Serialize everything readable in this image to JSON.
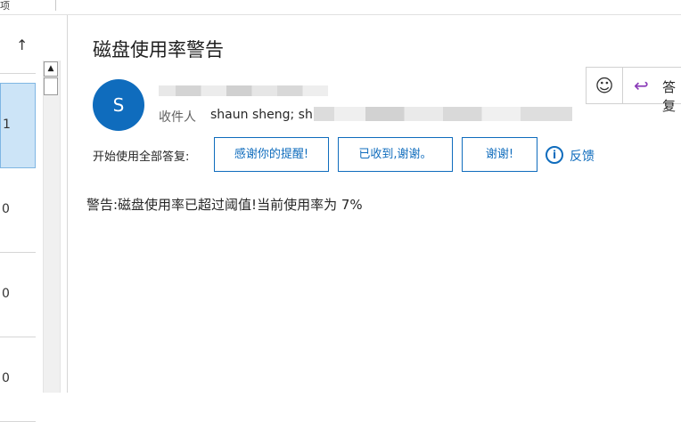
{
  "topbar": {
    "partial_text": "项"
  },
  "list": {
    "rows": [
      {
        "value": "1"
      },
      {
        "value": "0"
      },
      {
        "value": "0"
      },
      {
        "value": "0"
      }
    ]
  },
  "message": {
    "subject": "磁盘使用率警告",
    "avatar_initial": "S",
    "to_label": "收件人",
    "to_value": "shaun sheng; sh",
    "actions": {
      "emoji": "☺",
      "reply_label": "答复"
    },
    "quick_replies": {
      "label": "开始使用全部答复:",
      "buttons": [
        "感谢你的提醒!",
        "已收到,谢谢。",
        "谢谢!"
      ],
      "feedback": "反馈"
    },
    "body": "警告:磁盘使用率已超过阈值!当前使用率为 7%"
  },
  "colors": {
    "accent": "#0f6cbd",
    "reply_icon": "#8a3bb8",
    "selected_row": "#cce4f7"
  }
}
